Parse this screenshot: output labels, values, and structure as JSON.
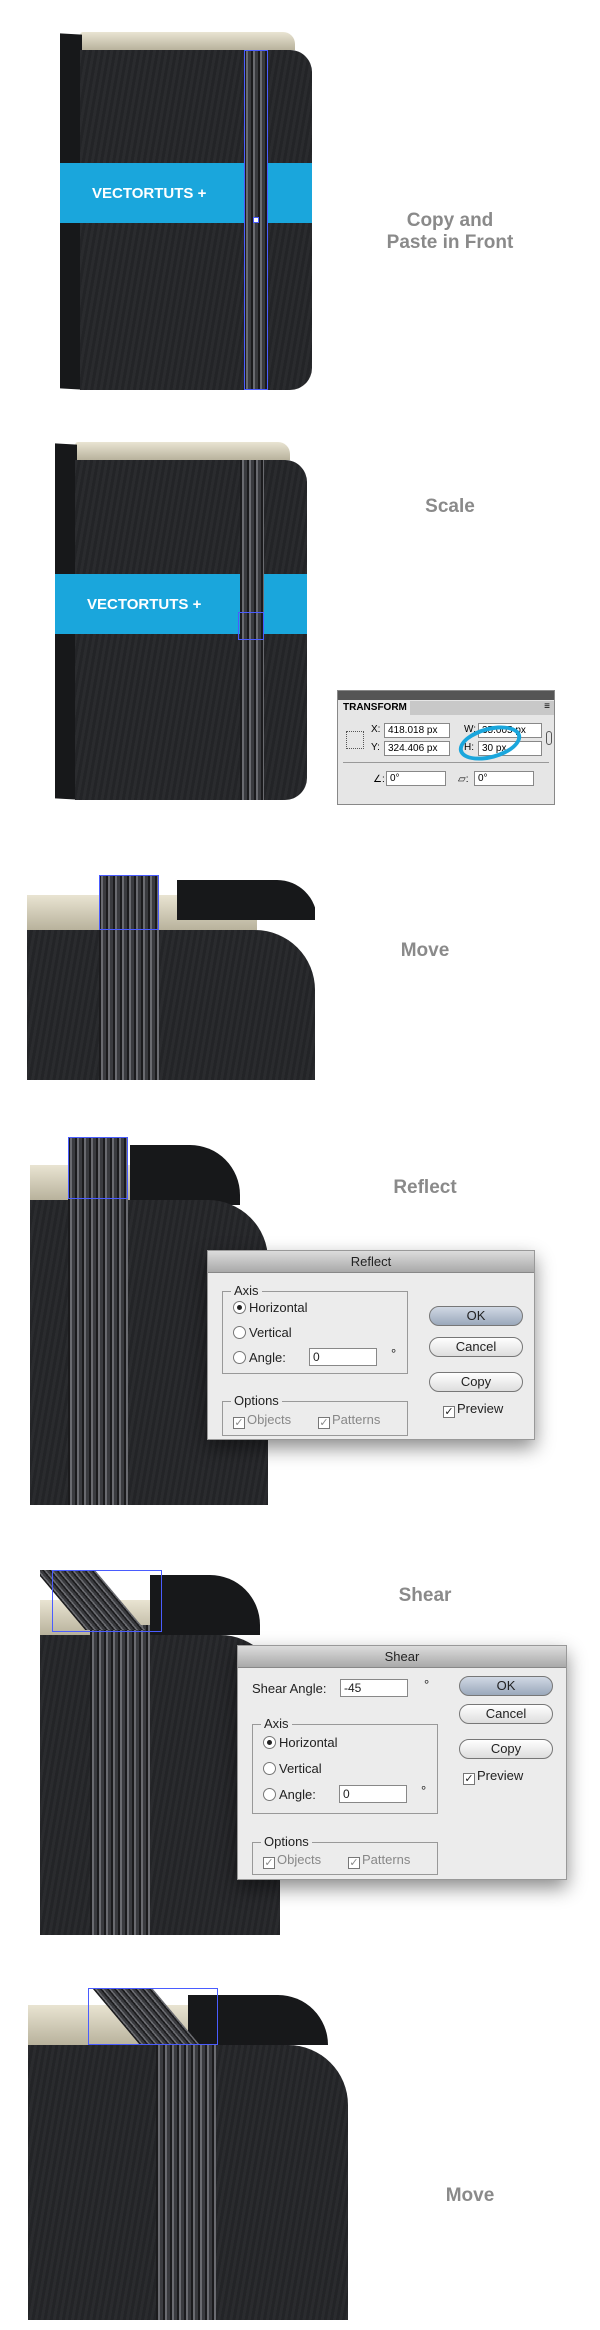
{
  "book_label": "VECTORTUTS +",
  "steps": [
    {
      "label": "Copy and Paste in Front"
    },
    {
      "label": "Scale"
    },
    {
      "label": "Move"
    },
    {
      "label": "Reflect"
    },
    {
      "label": "Shear"
    },
    {
      "label": "Move"
    }
  ],
  "colors": {
    "accent": "#1aa6dc",
    "cover": "#26272a",
    "selection": "#4a5cff"
  },
  "transform": {
    "tab": "TRANSFORM",
    "x_label": "X:",
    "x": "418.018 px",
    "y_label": "Y:",
    "y": "324.406 px",
    "w_label": "W:",
    "w": "35.005 px",
    "h_label": "H:",
    "h": "30 px",
    "rotate": "0°",
    "shear": "0°"
  },
  "reflect": {
    "title": "Reflect",
    "axis": "Axis",
    "horizontal": "Horizontal",
    "vertical": "Vertical",
    "angle_label": "Angle:",
    "angle": "0",
    "degree": "°",
    "options": "Options",
    "objects": "Objects",
    "patterns": "Patterns",
    "ok": "OK",
    "cancel": "Cancel",
    "copy": "Copy",
    "preview": "Preview"
  },
  "shear": {
    "title": "Shear",
    "shear_angle_label": "Shear Angle:",
    "shear_angle": "-45",
    "degree": "°",
    "axis": "Axis",
    "horizontal": "Horizontal",
    "vertical": "Vertical",
    "angle_label": "Angle:",
    "angle": "0",
    "options": "Options",
    "objects": "Objects",
    "patterns": "Patterns",
    "ok": "OK",
    "cancel": "Cancel",
    "copy": "Copy",
    "preview": "Preview"
  }
}
